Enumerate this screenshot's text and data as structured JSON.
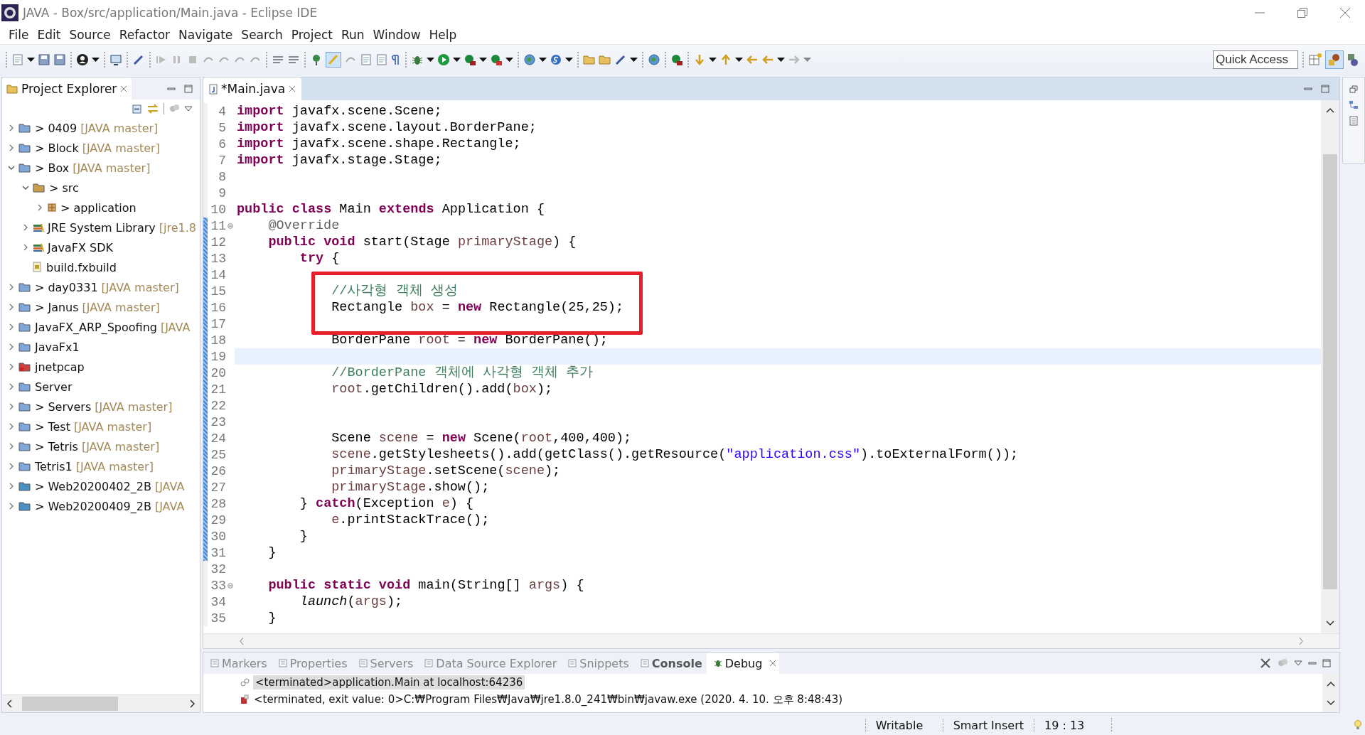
{
  "window": {
    "title": "JAVA - Box/src/application/Main.java - Eclipse IDE"
  },
  "menu": [
    "File",
    "Edit",
    "Source",
    "Refactor",
    "Navigate",
    "Search",
    "Project",
    "Run",
    "Window",
    "Help"
  ],
  "quick_access": {
    "placeholder": "Quick Access"
  },
  "project_explorer": {
    "title": "Project Explorer",
    "items": [
      {
        "label": "0409",
        "prefix": ">",
        "decoration": "[JAVA master]",
        "kind": "project",
        "expanded": false
      },
      {
        "label": "Block",
        "prefix": ">",
        "decoration": "[JAVA master]",
        "kind": "project",
        "expanded": false
      },
      {
        "label": "Box",
        "prefix": ">",
        "decoration": "[JAVA master]",
        "kind": "project",
        "expanded": true,
        "children": [
          {
            "label": "src",
            "prefix": ">",
            "kind": "source",
            "expanded": true,
            "children": [
              {
                "label": "application",
                "prefix": ">",
                "kind": "package",
                "expanded": false
              }
            ]
          },
          {
            "label": "JRE System Library",
            "decoration": "[jre1.8",
            "kind": "library",
            "expanded": false
          },
          {
            "label": "JavaFX SDK",
            "kind": "library",
            "expanded": false
          },
          {
            "label": "build.fxbuild",
            "kind": "file"
          }
        ]
      },
      {
        "label": "day0331",
        "prefix": ">",
        "decoration": "[JAVA master]",
        "kind": "project",
        "expanded": false
      },
      {
        "label": "Janus",
        "prefix": ">",
        "decoration": "[JAVA master]",
        "kind": "project",
        "expanded": false
      },
      {
        "label": "JavaFX_ARP_Spoofing",
        "decoration": "[JAVA",
        "kind": "project",
        "expanded": false
      },
      {
        "label": "JavaFx1",
        "kind": "project",
        "expanded": false
      },
      {
        "label": "jnetpcap",
        "kind": "error-project",
        "expanded": false
      },
      {
        "label": "Server",
        "kind": "project",
        "expanded": false
      },
      {
        "label": "Servers",
        "prefix": ">",
        "decoration": "[JAVA master]",
        "kind": "project",
        "expanded": false
      },
      {
        "label": "Test",
        "prefix": ">",
        "decoration": "[JAVA master]",
        "kind": "project",
        "expanded": false
      },
      {
        "label": "Tetris",
        "prefix": ">",
        "decoration": "[JAVA master]",
        "kind": "project",
        "expanded": false
      },
      {
        "label": "Tetris1",
        "decoration": "[JAVA master]",
        "kind": "project",
        "expanded": false
      },
      {
        "label": "Web20200402_2B",
        "prefix": ">",
        "decoration": "[JAVA",
        "kind": "web-project",
        "expanded": false
      },
      {
        "label": "Web20200409_2B",
        "prefix": ">",
        "decoration": "[JAVA",
        "kind": "web-project",
        "expanded": false
      }
    ]
  },
  "editor": {
    "tab": {
      "label": "*Main.java",
      "selected": true
    },
    "lines": [
      {
        "n": "4",
        "tokens": [
          {
            "kind": "keyword",
            "text": "import"
          },
          {
            "kind": "plain",
            "text": " javafx.scene.Scene;"
          }
        ],
        "changed": false,
        "current": false,
        "boxed": false,
        "fold": false
      },
      {
        "n": "5",
        "tokens": [
          {
            "kind": "keyword",
            "text": "import"
          },
          {
            "kind": "plain",
            "text": " javafx.scene.layout.BorderPane;"
          }
        ],
        "changed": false,
        "current": false,
        "boxed": false,
        "fold": false
      },
      {
        "n": "6",
        "tokens": [
          {
            "kind": "keyword",
            "text": "import"
          },
          {
            "kind": "plain",
            "text": " javafx.scene.shape.Rectangle;"
          }
        ],
        "changed": false,
        "current": false,
        "boxed": false,
        "fold": false
      },
      {
        "n": "7",
        "tokens": [
          {
            "kind": "keyword",
            "text": "import"
          },
          {
            "kind": "plain",
            "text": " javafx.stage.Stage;"
          }
        ],
        "changed": false,
        "current": false,
        "boxed": false,
        "fold": false
      },
      {
        "n": "8",
        "changed": false,
        "current": false,
        "boxed": false,
        "fold": false
      },
      {
        "n": "9",
        "changed": false,
        "current": false,
        "boxed": false,
        "fold": false
      },
      {
        "n": "10",
        "tokens": [
          {
            "kind": "keyword",
            "text": "public"
          },
          {
            "kind": "keyword",
            "text": " class"
          },
          {
            "kind": "plain",
            "text": " Main"
          },
          {
            "kind": "keyword",
            "text": " extends"
          },
          {
            "kind": "plain",
            "text": " Application {"
          }
        ],
        "changed": false,
        "current": false,
        "boxed": false,
        "fold": false
      },
      {
        "n": "11",
        "tokens": [
          {
            "kind": "annotation",
            "text": "    @Override"
          }
        ],
        "changed": true,
        "current": false,
        "boxed": false,
        "fold": true
      },
      {
        "n": "12",
        "tokens": [
          {
            "kind": "keyword",
            "text": "    public"
          },
          {
            "kind": "keyword",
            "text": " void"
          },
          {
            "kind": "plain",
            "text": " start(Stage"
          },
          {
            "kind": "variable",
            "text": " primaryStage"
          },
          {
            "kind": "plain",
            "text": ") {"
          }
        ],
        "changed": true,
        "current": false,
        "boxed": false,
        "fold": false
      },
      {
        "n": "13",
        "tokens": [
          {
            "kind": "keyword",
            "text": "        try"
          },
          {
            "kind": "plain",
            "text": " {"
          }
        ],
        "changed": true,
        "current": false,
        "boxed": false,
        "fold": false
      },
      {
        "n": "14",
        "changed": true,
        "current": false,
        "boxed": false,
        "fold": false
      },
      {
        "n": "15",
        "tokens": [
          {
            "kind": "comment",
            "text": "            //사각형 객체 생성"
          }
        ],
        "changed": true,
        "current": false,
        "boxed": true,
        "fold": false
      },
      {
        "n": "16",
        "tokens": [
          {
            "kind": "plain",
            "text": "            Rectangle"
          },
          {
            "kind": "variable",
            "text": " box"
          },
          {
            "kind": "plain",
            "text": " ="
          },
          {
            "kind": "keyword",
            "text": " new"
          },
          {
            "kind": "plain",
            "text": " Rectangle(25,25);"
          }
        ],
        "changed": true,
        "current": false,
        "boxed": true,
        "fold": false
      },
      {
        "n": "17",
        "changed": true,
        "current": false,
        "boxed": true,
        "fold": false
      },
      {
        "n": "18",
        "tokens": [
          {
            "kind": "plain",
            "text": "            BorderPane"
          },
          {
            "kind": "variable",
            "text": " root"
          },
          {
            "kind": "plain",
            "text": " ="
          },
          {
            "kind": "keyword",
            "text": " new"
          },
          {
            "kind": "plain",
            "text": " BorderPane();"
          }
        ],
        "changed": true,
        "current": false,
        "boxed": false,
        "fold": false
      },
      {
        "n": "19",
        "changed": true,
        "current": true,
        "boxed": false,
        "fold": false
      },
      {
        "n": "20",
        "tokens": [
          {
            "kind": "comment",
            "text": "            //BorderPane 객체에 사각형 객체 추가"
          }
        ],
        "changed": true,
        "current": false,
        "boxed": false,
        "fold": false
      },
      {
        "n": "21",
        "tokens": [
          {
            "kind": "variable",
            "text": "            root"
          },
          {
            "kind": "plain",
            "text": ".getChildren().add("
          },
          {
            "kind": "variable",
            "text": "box"
          },
          {
            "kind": "plain",
            "text": ");"
          }
        ],
        "changed": true,
        "current": false,
        "boxed": false,
        "fold": false
      },
      {
        "n": "22",
        "changed": true,
        "current": false,
        "boxed": false,
        "fold": false
      },
      {
        "n": "23",
        "changed": true,
        "current": false,
        "boxed": false,
        "fold": false
      },
      {
        "n": "24",
        "tokens": [
          {
            "kind": "plain",
            "text": "            Scene"
          },
          {
            "kind": "variable",
            "text": " scene"
          },
          {
            "kind": "plain",
            "text": " ="
          },
          {
            "kind": "keyword",
            "text": " new"
          },
          {
            "kind": "plain",
            "text": " Scene("
          },
          {
            "kind": "variable",
            "text": "root"
          },
          {
            "kind": "plain",
            "text": ",400,400);"
          }
        ],
        "changed": true,
        "current": false,
        "boxed": false,
        "fold": false
      },
      {
        "n": "25",
        "tokens": [
          {
            "kind": "variable",
            "text": "            scene"
          },
          {
            "kind": "plain",
            "text": ".getStylesheets().add(getClass().getResource("
          },
          {
            "kind": "string",
            "text": "\"application.css\""
          },
          {
            "kind": "plain",
            "text": ").toExternalForm());"
          }
        ],
        "changed": true,
        "current": false,
        "boxed": false,
        "fold": false
      },
      {
        "n": "26",
        "tokens": [
          {
            "kind": "variable",
            "text": "            primaryStage"
          },
          {
            "kind": "plain",
            "text": ".setScene("
          },
          {
            "kind": "variable",
            "text": "scene"
          },
          {
            "kind": "plain",
            "text": ");"
          }
        ],
        "changed": true,
        "current": false,
        "boxed": false,
        "fold": false
      },
      {
        "n": "27",
        "tokens": [
          {
            "kind": "variable",
            "text": "            primaryStage"
          },
          {
            "kind": "plain",
            "text": ".show();"
          }
        ],
        "changed": true,
        "current": false,
        "boxed": false,
        "fold": false
      },
      {
        "n": "28",
        "tokens": [
          {
            "kind": "plain",
            "text": "        }"
          },
          {
            "kind": "keyword",
            "text": " catch"
          },
          {
            "kind": "plain",
            "text": "(Exception"
          },
          {
            "kind": "variable",
            "text": " e"
          },
          {
            "kind": "plain",
            "text": ") {"
          }
        ],
        "changed": true,
        "current": false,
        "boxed": false,
        "fold": false
      },
      {
        "n": "29",
        "tokens": [
          {
            "kind": "variable",
            "text": "            e"
          },
          {
            "kind": "plain",
            "text": ".printStackTrace();"
          }
        ],
        "changed": true,
        "current": false,
        "boxed": false,
        "fold": false
      },
      {
        "n": "30",
        "tokens": [
          {
            "kind": "plain",
            "text": "        }"
          }
        ],
        "changed": true,
        "current": false,
        "boxed": false,
        "fold": false
      },
      {
        "n": "31",
        "tokens": [
          {
            "kind": "plain",
            "text": "    }"
          }
        ],
        "changed": true,
        "current": false,
        "boxed": false,
        "fold": false
      },
      {
        "n": "32",
        "changed": false,
        "current": false,
        "boxed": false,
        "fold": false
      },
      {
        "n": "33",
        "tokens": [
          {
            "kind": "keyword",
            "text": "    public"
          },
          {
            "kind": "keyword",
            "text": " static"
          },
          {
            "kind": "keyword",
            "text": " void"
          },
          {
            "kind": "plain",
            "text": " main(String[]"
          },
          {
            "kind": "variable",
            "text": " args"
          },
          {
            "kind": "plain",
            "text": ") {"
          }
        ],
        "changed": false,
        "current": false,
        "boxed": false,
        "fold": true
      },
      {
        "n": "34",
        "tokens": [
          {
            "kind": "static-call",
            "text": "        launch"
          },
          {
            "kind": "plain",
            "text": "("
          },
          {
            "kind": "variable",
            "text": "args"
          },
          {
            "kind": "plain",
            "text": ");"
          }
        ],
        "changed": false,
        "current": false,
        "boxed": false,
        "fold": false
      },
      {
        "n": "35",
        "tokens": [
          {
            "kind": "plain",
            "text": "    }"
          }
        ],
        "changed": false,
        "current": false,
        "boxed": false,
        "fold": false
      }
    ]
  },
  "bottom_panel": {
    "tabs": [
      {
        "label": "Markers",
        "selected": false,
        "emphasized": false
      },
      {
        "label": "Properties",
        "selected": false,
        "emphasized": false
      },
      {
        "label": "Servers",
        "selected": false,
        "emphasized": false
      },
      {
        "label": "Data Source Explorer",
        "selected": false,
        "emphasized": false
      },
      {
        "label": "Snippets",
        "selected": false,
        "emphasized": false
      },
      {
        "label": "Console",
        "selected": false,
        "emphasized": true
      },
      {
        "label": "Debug",
        "selected": true,
        "emphasized": false
      }
    ],
    "rows": [
      {
        "text": "<terminated>application.Main at localhost:64236",
        "kind": "launch",
        "selected": true
      },
      {
        "text": "<terminated, exit value: 0>C:₩Program Files₩Java₩jre1.8.0_241₩bin₩javaw.exe (2020. 4. 10. 오후 8:48:43)",
        "kind": "process",
        "selected": false
      }
    ]
  },
  "status_bar": [
    "Writable",
    "Smart Insert",
    "19 : 13"
  ]
}
